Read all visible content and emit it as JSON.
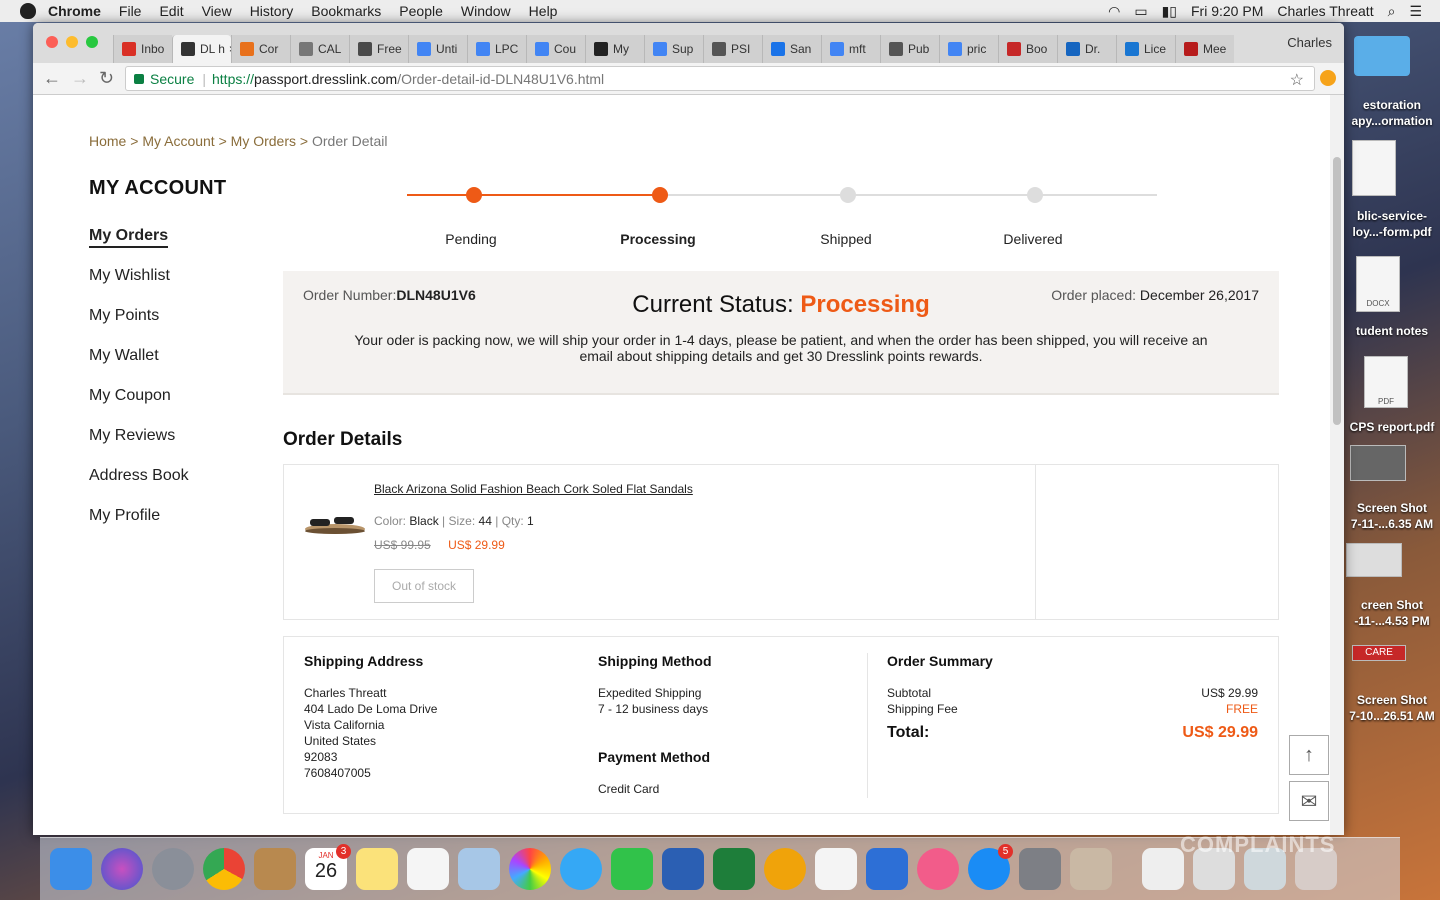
{
  "menubar": {
    "app": "Chrome",
    "items": [
      "File",
      "Edit",
      "View",
      "History",
      "Bookmarks",
      "People",
      "Window",
      "Help"
    ],
    "clock": "Fri 9:20 PM",
    "user": "Charles Threatt"
  },
  "browser": {
    "tabs": [
      {
        "label": "Inbo",
        "color": "#d93025"
      },
      {
        "label": "DL h",
        "color": "#333333"
      },
      {
        "label": "Cor",
        "color": "#e8711c"
      },
      {
        "label": "CAL",
        "color": "#777777"
      },
      {
        "label": "Free",
        "color": "#4a4a4a"
      },
      {
        "label": "Unti",
        "color": "#4285f4"
      },
      {
        "label": "LPC",
        "color": "#4285f4"
      },
      {
        "label": "Cou",
        "color": "#4285f4"
      },
      {
        "label": "My",
        "color": "#222222"
      },
      {
        "label": "Sup",
        "color": "#4285f4"
      },
      {
        "label": "PSI",
        "color": "#555555"
      },
      {
        "label": "San",
        "color": "#1a73e8"
      },
      {
        "label": "mft",
        "color": "#4285f4"
      },
      {
        "label": "Pub",
        "color": "#555555"
      },
      {
        "label": "pric",
        "color": "#4285f4"
      },
      {
        "label": "Boo",
        "color": "#c62828"
      },
      {
        "label": "Dr.",
        "color": "#1565c0"
      },
      {
        "label": "Lice",
        "color": "#1976d2"
      },
      {
        "label": "Mee",
        "color": "#b71c1c"
      }
    ],
    "profile": "Charles",
    "secure_label": "Secure",
    "url_proto": "https://",
    "url_host": "passport.dresslink.com",
    "url_path": "/Order-detail-id-DLN48U1V6.html"
  },
  "breadcrumb": {
    "home": "Home",
    "account": "My Account",
    "orders": "My Orders",
    "current": "Order Detail",
    "sep": ">"
  },
  "sidebar": {
    "title": "MY ACCOUNT",
    "items": [
      "My Orders",
      "My Wishlist",
      "My Points",
      "My Wallet",
      "My Coupon",
      "My Reviews",
      "Address Book",
      "My Profile"
    ]
  },
  "tracker": {
    "steps": [
      "Pending",
      "Processing",
      "Shipped",
      "Delivered"
    ],
    "current_step": 2
  },
  "status": {
    "order_number_label": "Order Number:",
    "order_number": "DLN48U1V6",
    "current_label": "Current Status: ",
    "current_value": "Processing",
    "placed_label": "Order placed: ",
    "placed_value": "December 26,2017",
    "message": "Your oder is packing now, we will ship your order in 1-4 days, please be patient, and when the order has been shipped, you will receive an email about shipping details and get 30 Dresslink points rewards."
  },
  "order_details": {
    "title": "Order Details",
    "item": {
      "name": "Black Arizona Solid Fashion Beach Cork Soled Flat Sandals",
      "color_label": "Color:",
      "color": "Black",
      "size_label": "Size:",
      "size": "44",
      "qty_label": "Qty:",
      "qty": "1",
      "old_price": "US$ 99.95",
      "price": "US$ 29.99",
      "stock_button": "Out of stock"
    }
  },
  "shipping_address": {
    "title": "Shipping Address",
    "lines": [
      "Charles Threatt",
      "404 Lado De Loma Drive",
      "Vista California",
      "United States",
      "92083",
      "7608407005"
    ]
  },
  "shipping_method": {
    "title": "Shipping Method",
    "name": "Expedited Shipping",
    "eta": "7 - 12 business days"
  },
  "payment_method": {
    "title": "Payment Method",
    "value": "Credit Card"
  },
  "summary": {
    "title": "Order Summary",
    "subtotal_label": "Subtotal",
    "subtotal": "US$ 29.99",
    "shipping_label": "Shipping Fee",
    "shipping": "FREE",
    "total_label": "Total:",
    "total": "US$ 29.99"
  },
  "desktop": {
    "files": [
      "estoration",
      "apy...ormation",
      "blic-service-",
      "loy...-form.pdf",
      "DOCX",
      "tudent notes",
      "PDF",
      "CPS report.pdf",
      "Screen Shot",
      "7-11-...6.35 AM",
      "creen Shot",
      "-11-...4.53 PM",
      "CARE",
      "Screen Shot",
      "7-10...26.51 AM"
    ]
  },
  "dock": {
    "calendar_month": "JAN",
    "calendar_day": "26",
    "calendar_badge": "3",
    "appstore_badge": "5"
  },
  "watermark": "COMPLAINTS",
  "colors": {
    "accent": "#ee5a16",
    "inactive_step": "#dddddd",
    "breadcrumb": "#8a6d3b"
  }
}
